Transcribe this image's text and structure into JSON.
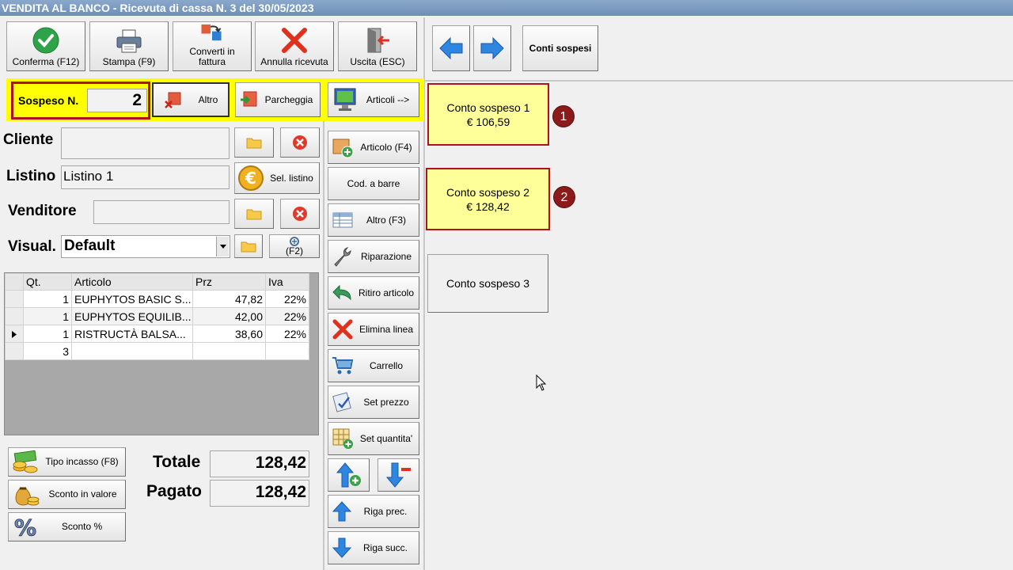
{
  "window": {
    "title": "VENDITA AL BANCO - Ricevuta di cassa N. 3 del 30/05/2023"
  },
  "toolbar": {
    "conferma": "Conferma (F12)",
    "stampa": "Stampa (F9)",
    "converti_line1": "Converti in",
    "converti_line2": "fattura",
    "annulla": "Annulla ricevuta",
    "uscita": "Uscita (ESC)"
  },
  "right_toolbar": {
    "conti_sospesi": "Conti sospesi"
  },
  "sospeso": {
    "label": "Sospeso N.",
    "value": "2",
    "altro": "Altro",
    "parcheggia": "Parcheggia",
    "articoli": "Articoli -->"
  },
  "form": {
    "cliente_label": "Cliente",
    "cliente_value": "",
    "listino_label": "Listino",
    "listino_value": "Listino 1",
    "sel_listino": "Sel. listino",
    "venditore_label": "Venditore",
    "venditore_value": "",
    "visual_label": "Visual.",
    "visual_value": "Default",
    "f2_label": "(F2)"
  },
  "table": {
    "headers": {
      "qt": "Qt.",
      "articolo": "Articolo",
      "prz": "Prz",
      "iva": "Iva"
    },
    "rows": [
      {
        "qt": "1",
        "articolo": "EUPHYTOS BASIC S...",
        "prz": "47,82",
        "iva": "22%"
      },
      {
        "qt": "1",
        "articolo": "EUPHYTOS EQUILIB...",
        "prz": "42,00",
        "iva": "22%"
      },
      {
        "qt": "1",
        "articolo": "RISTRUCTÀ BALSA...",
        "prz": "38,60",
        "iva": "22%"
      }
    ],
    "new_row_qt": "3"
  },
  "actions": {
    "tipo_incasso": "Tipo incasso (F8)",
    "sconto_valore": "Sconto in valore",
    "sconto_perc": "Sconto %"
  },
  "totals": {
    "totale_label": "Totale",
    "totale_value": "128,42",
    "pagato_label": "Pagato",
    "pagato_value": "128,42"
  },
  "side_buttons": {
    "articolo": "Articolo (F4)",
    "cod_barre": "Cod. a barre",
    "altro": "Altro (F3)",
    "riparazione": "Riparazione",
    "ritiro": "Ritiro articolo",
    "elimina": "Elimina linea",
    "carrello": "Carrello",
    "set_prezzo": "Set prezzo",
    "set_quantita": "Set quantita'",
    "riga_prec": "Riga prec.",
    "riga_succ": "Riga succ."
  },
  "conti": [
    {
      "name": "Conto sospeso 1",
      "amount": "€ 106,59",
      "badge": "1"
    },
    {
      "name": "Conto sospeso 2",
      "amount": "€ 128,42",
      "badge": "2"
    },
    {
      "name": "Conto sospeso 3"
    }
  ],
  "colors": {
    "highlight_yellow": "#ffff00",
    "conto_yellow": "#ffff99",
    "red_border": "#b01020",
    "badge": "#8b1a1a",
    "title_blue": "#7895bd"
  }
}
